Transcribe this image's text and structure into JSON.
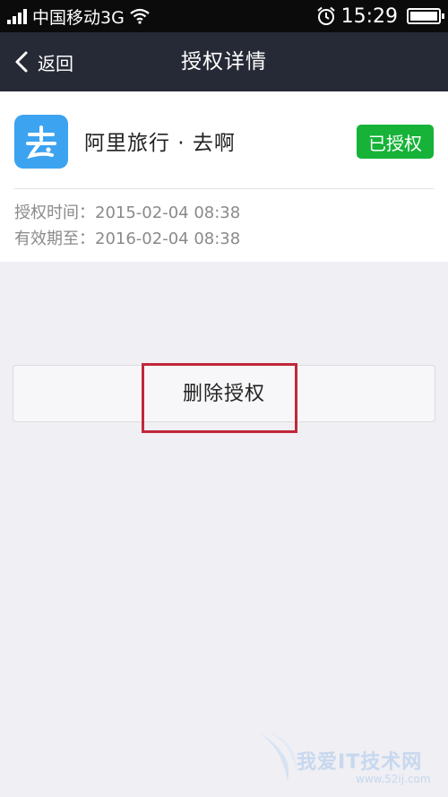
{
  "status_bar": {
    "carrier": "中国移动3G",
    "time": "15:29",
    "battery_level": 1.0,
    "icons": [
      "signal-icon",
      "wifi-icon",
      "alarm-icon",
      "battery-icon"
    ]
  },
  "nav": {
    "back_label": "返回",
    "title": "授权详情",
    "bg_color": "#262a36"
  },
  "app": {
    "name": "阿里旅行 · 去啊",
    "icon": "qua-app-icon",
    "icon_color": "#3ca3f0",
    "status": "已授权",
    "status_color": "#16b338",
    "auth_time": "授权时间：2015-02-04 08:38",
    "valid_until": "有效期至：2016-02-04 08:38"
  },
  "actions": {
    "delete_label": "删除授权",
    "highlight_color": "#c0283a"
  },
  "watermark": {
    "text": "我爱IT技术网",
    "sub": "www.52ij.com"
  }
}
